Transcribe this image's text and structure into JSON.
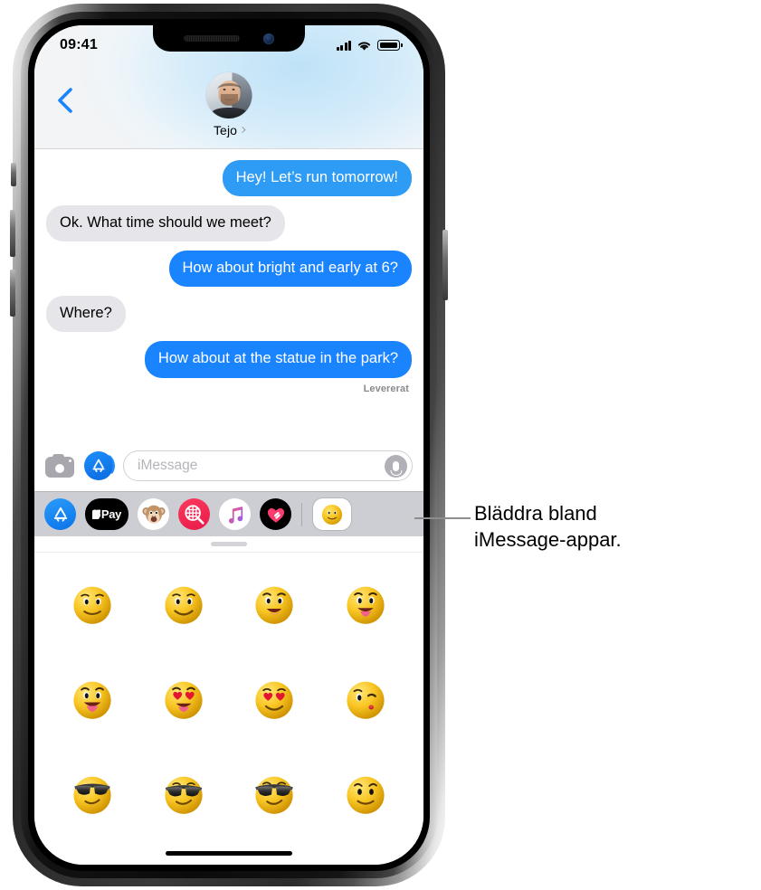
{
  "status_bar": {
    "time": "09:41",
    "signal_icon": "cellular-signal-icon",
    "wifi_icon": "wifi-icon",
    "battery_icon": "battery-full-icon"
  },
  "header": {
    "back_icon": "chevron-left-icon",
    "avatar_icon": "contact-avatar",
    "contact_name": "Tejo",
    "contact_chevron_icon": "chevron-right-icon"
  },
  "conversation": {
    "messages": [
      {
        "text": "Hey! Let’s run tomorrow!",
        "side": "out"
      },
      {
        "text": "Ok. What time should we meet?",
        "side": "in"
      },
      {
        "text": "How about bright and early at 6?",
        "side": "out"
      },
      {
        "text": "Where?",
        "side": "in"
      },
      {
        "text": "How about at the statue in the park?",
        "side": "out"
      }
    ],
    "delivered_label": "Levererat"
  },
  "input_bar": {
    "camera_icon": "camera-icon",
    "appstore_icon": "app-store-icon",
    "placeholder": "iMessage",
    "value": "",
    "mic_icon": "microphone-icon"
  },
  "app_drawer": {
    "apps": [
      {
        "name": "app-store-app",
        "label": ""
      },
      {
        "name": "apple-pay-app",
        "label": "Pay"
      },
      {
        "name": "memoji-app",
        "label": ""
      },
      {
        "name": "images-app",
        "label": ""
      },
      {
        "name": "apple-music-app",
        "label": ""
      },
      {
        "name": "digital-touch-app",
        "label": ""
      }
    ],
    "selected_app": "emoji-stickers-app"
  },
  "sticker_panel": {
    "grabber": "drag-handle",
    "stickers": [
      "slight-smile-face",
      "smiling-face",
      "grinning-face",
      "tongue-out-face",
      "tongue-out-open-face",
      "heart-eyes-tongue-face",
      "heart-eyes-face",
      "kissing-wink-face",
      "sunglasses-face-1",
      "sunglasses-face-2",
      "sunglasses-face-3",
      "smirk-raised-brow-face"
    ]
  },
  "callout": {
    "text": "Bläddra bland\niMessage-appar.",
    "leader_line": "callout-leader-line"
  },
  "colors": {
    "bubble_out": "#1a84ff",
    "bubble_out_light": "#2e9bf5",
    "bubble_in": "#e5e5ea",
    "accent_blue": "#1a84ff",
    "drawer_bg": "#cdced4",
    "delivered_text": "#8a8a8e"
  }
}
